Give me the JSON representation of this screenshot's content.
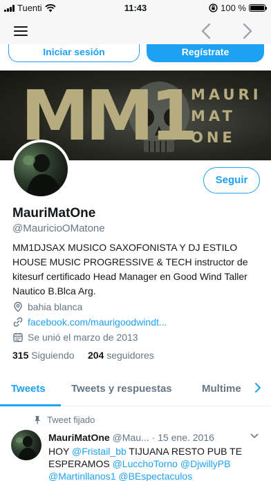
{
  "status_bar": {
    "carrier": "Tuenti",
    "time": "11:43",
    "battery_text": "100 %",
    "battery_level": 1.0,
    "icons": [
      "signal-icon",
      "wifi-icon",
      "orientation-lock-icon",
      "battery-icon"
    ]
  },
  "navbar": {
    "icons": [
      "hamburger-menu-icon",
      "back-arrow-icon",
      "forward-arrow-icon"
    ]
  },
  "auth": {
    "login_label": "Iniciar sesión",
    "signup_label": "Regístrate"
  },
  "banner": {
    "big_text": "MM1",
    "side_lines": [
      "MAURI",
      "MAT",
      "ONE"
    ]
  },
  "profile": {
    "follow_label": "Seguir",
    "name": "MauriMatOne",
    "handle": "@MauricioOMatone",
    "bio": "MM1DJSAX MUSICO SAXOFONISTA Y DJ ESTILO HOUSE MUSIC PROGRESSIVE & TECH instructor de kitesurf certificado Head Manager en Good Wind Taller Nautico B.Blca Arg.",
    "location": "bahia blanca",
    "website": "facebook.com/maurigoodwindt...",
    "joined": "Se unió el marzo de 2013",
    "following_count": "315",
    "following_label": "Siguiendo",
    "followers_count": "204",
    "followers_label": "seguidores"
  },
  "tabs": {
    "items": [
      {
        "label": "Tweets"
      },
      {
        "label": "Tweets y respuestas"
      },
      {
        "label": "Multime"
      }
    ],
    "active_index": 0,
    "accent": "#1da1f2"
  },
  "tweet": {
    "pinned_label": "Tweet fijado",
    "author_name": "MauriMatOne",
    "author_handle": "@Mau...",
    "separator": "·",
    "date": "15 ene. 2016",
    "text_prefix": "HOY ",
    "mention_1": "@Fristail_bb",
    "text_mid": " TIJUANA RESTO PUB TE ESPERAMOS ",
    "mention_2": "@LucchoTorno",
    "mention_3": "@DjwillyPB",
    "mention_4": "@Martinllanos1",
    "mention_5": "@BEspectaculos"
  },
  "colors": {
    "accent": "#1da1f2",
    "text": "#14171a",
    "secondary": "#657786",
    "banner_gold": "#b7ab80"
  }
}
